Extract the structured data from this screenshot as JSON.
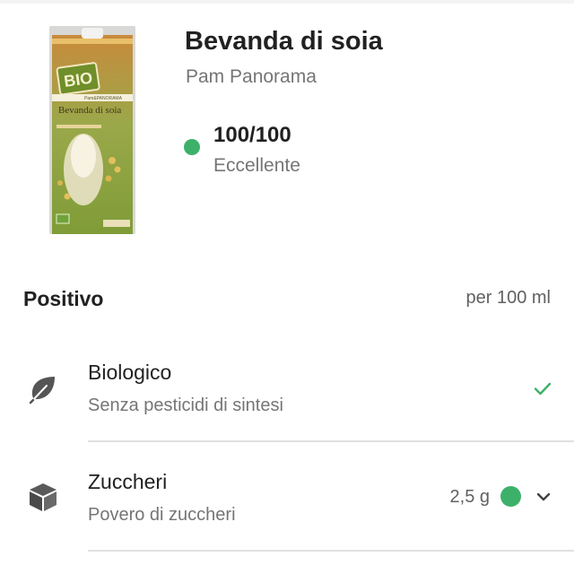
{
  "product": {
    "name": "Bevanda di soia",
    "brand": "Pam Panorama",
    "score": "100/100",
    "score_label": "Eccellente",
    "score_color": "#3db16a",
    "packaging_logo_text": "BIO",
    "packaging_brand_text": "Pam&PANORAMA",
    "packaging_name_text": "Bevanda di soia"
  },
  "section": {
    "title": "Positivo",
    "unit": "per 100 ml"
  },
  "items": [
    {
      "title": "Biologico",
      "subtitle": "Senza pesticidi di sintesi",
      "icon": "leaf-icon",
      "status_icon": "check-icon"
    },
    {
      "title": "Zuccheri",
      "subtitle": "Povero di zuccheri",
      "value": "2,5 g",
      "icon": "cube-icon",
      "status_color": "#3db16a",
      "status_icon": "chevron-down-icon"
    }
  ]
}
